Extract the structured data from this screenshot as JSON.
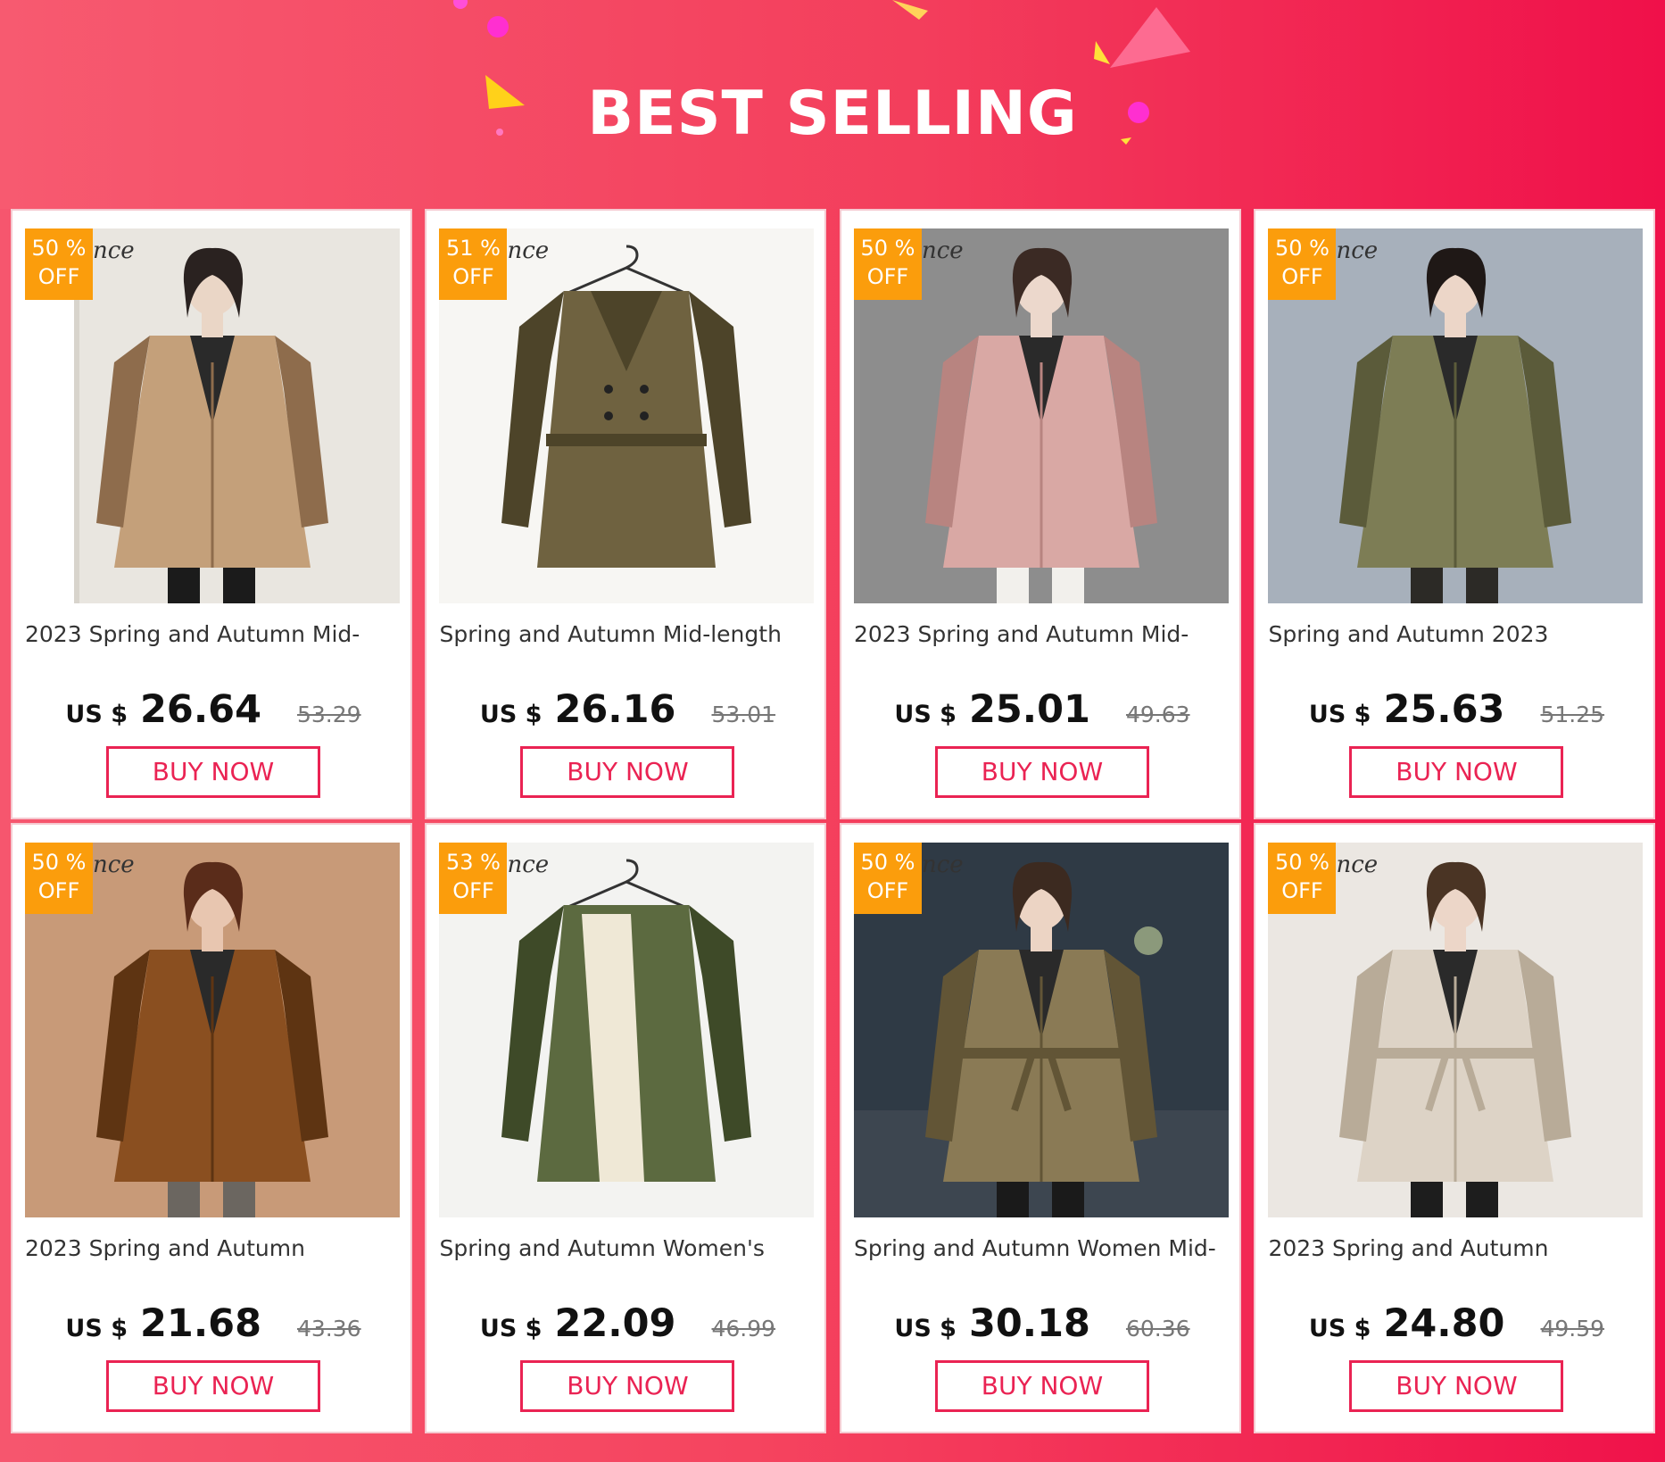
{
  "banner": {
    "title": "BEST SELLING"
  },
  "badge_off_label": "OFF",
  "watermark_text": "nce",
  "buy_label": "BUY NOW",
  "currency_label": "US $",
  "colors": {
    "accent": "#ea2353",
    "badge": "#fb9d0c",
    "banner": "#f0124a"
  },
  "products": [
    {
      "discount": "50 %",
      "title": "2023 Spring and Autumn Mid-",
      "price": "26.64",
      "old_price": "53.29",
      "image": "khaki-trench-coat"
    },
    {
      "discount": "51 %",
      "title": "Spring and Autumn Mid-length",
      "price": "26.16",
      "old_price": "53.01",
      "image": "olive-belted-trench"
    },
    {
      "discount": "50 %",
      "title": "2023 Spring and Autumn Mid-",
      "price": "25.01",
      "old_price": "49.63",
      "image": "pink-hooded-jacket"
    },
    {
      "discount": "50 %",
      "title": "Spring and Autumn 2023",
      "price": "25.63",
      "old_price": "51.25",
      "image": "army-green-parka"
    },
    {
      "discount": "50 %",
      "title": "2023 Spring and Autumn",
      "price": "21.68",
      "old_price": "43.36",
      "image": "brown-leather-jacket"
    },
    {
      "discount": "53 %",
      "title": "Spring and Autumn Women's",
      "price": "22.09",
      "old_price": "46.99",
      "image": "green-cream-layered-jacket"
    },
    {
      "discount": "50 %",
      "title": "Spring and Autumn Women Mid-",
      "price": "30.18",
      "old_price": "60.36",
      "image": "olive-short-trench"
    },
    {
      "discount": "50 %",
      "title": "2023 Spring and Autumn",
      "price": "24.80",
      "old_price": "49.59",
      "image": "cream-belted-trench"
    }
  ]
}
